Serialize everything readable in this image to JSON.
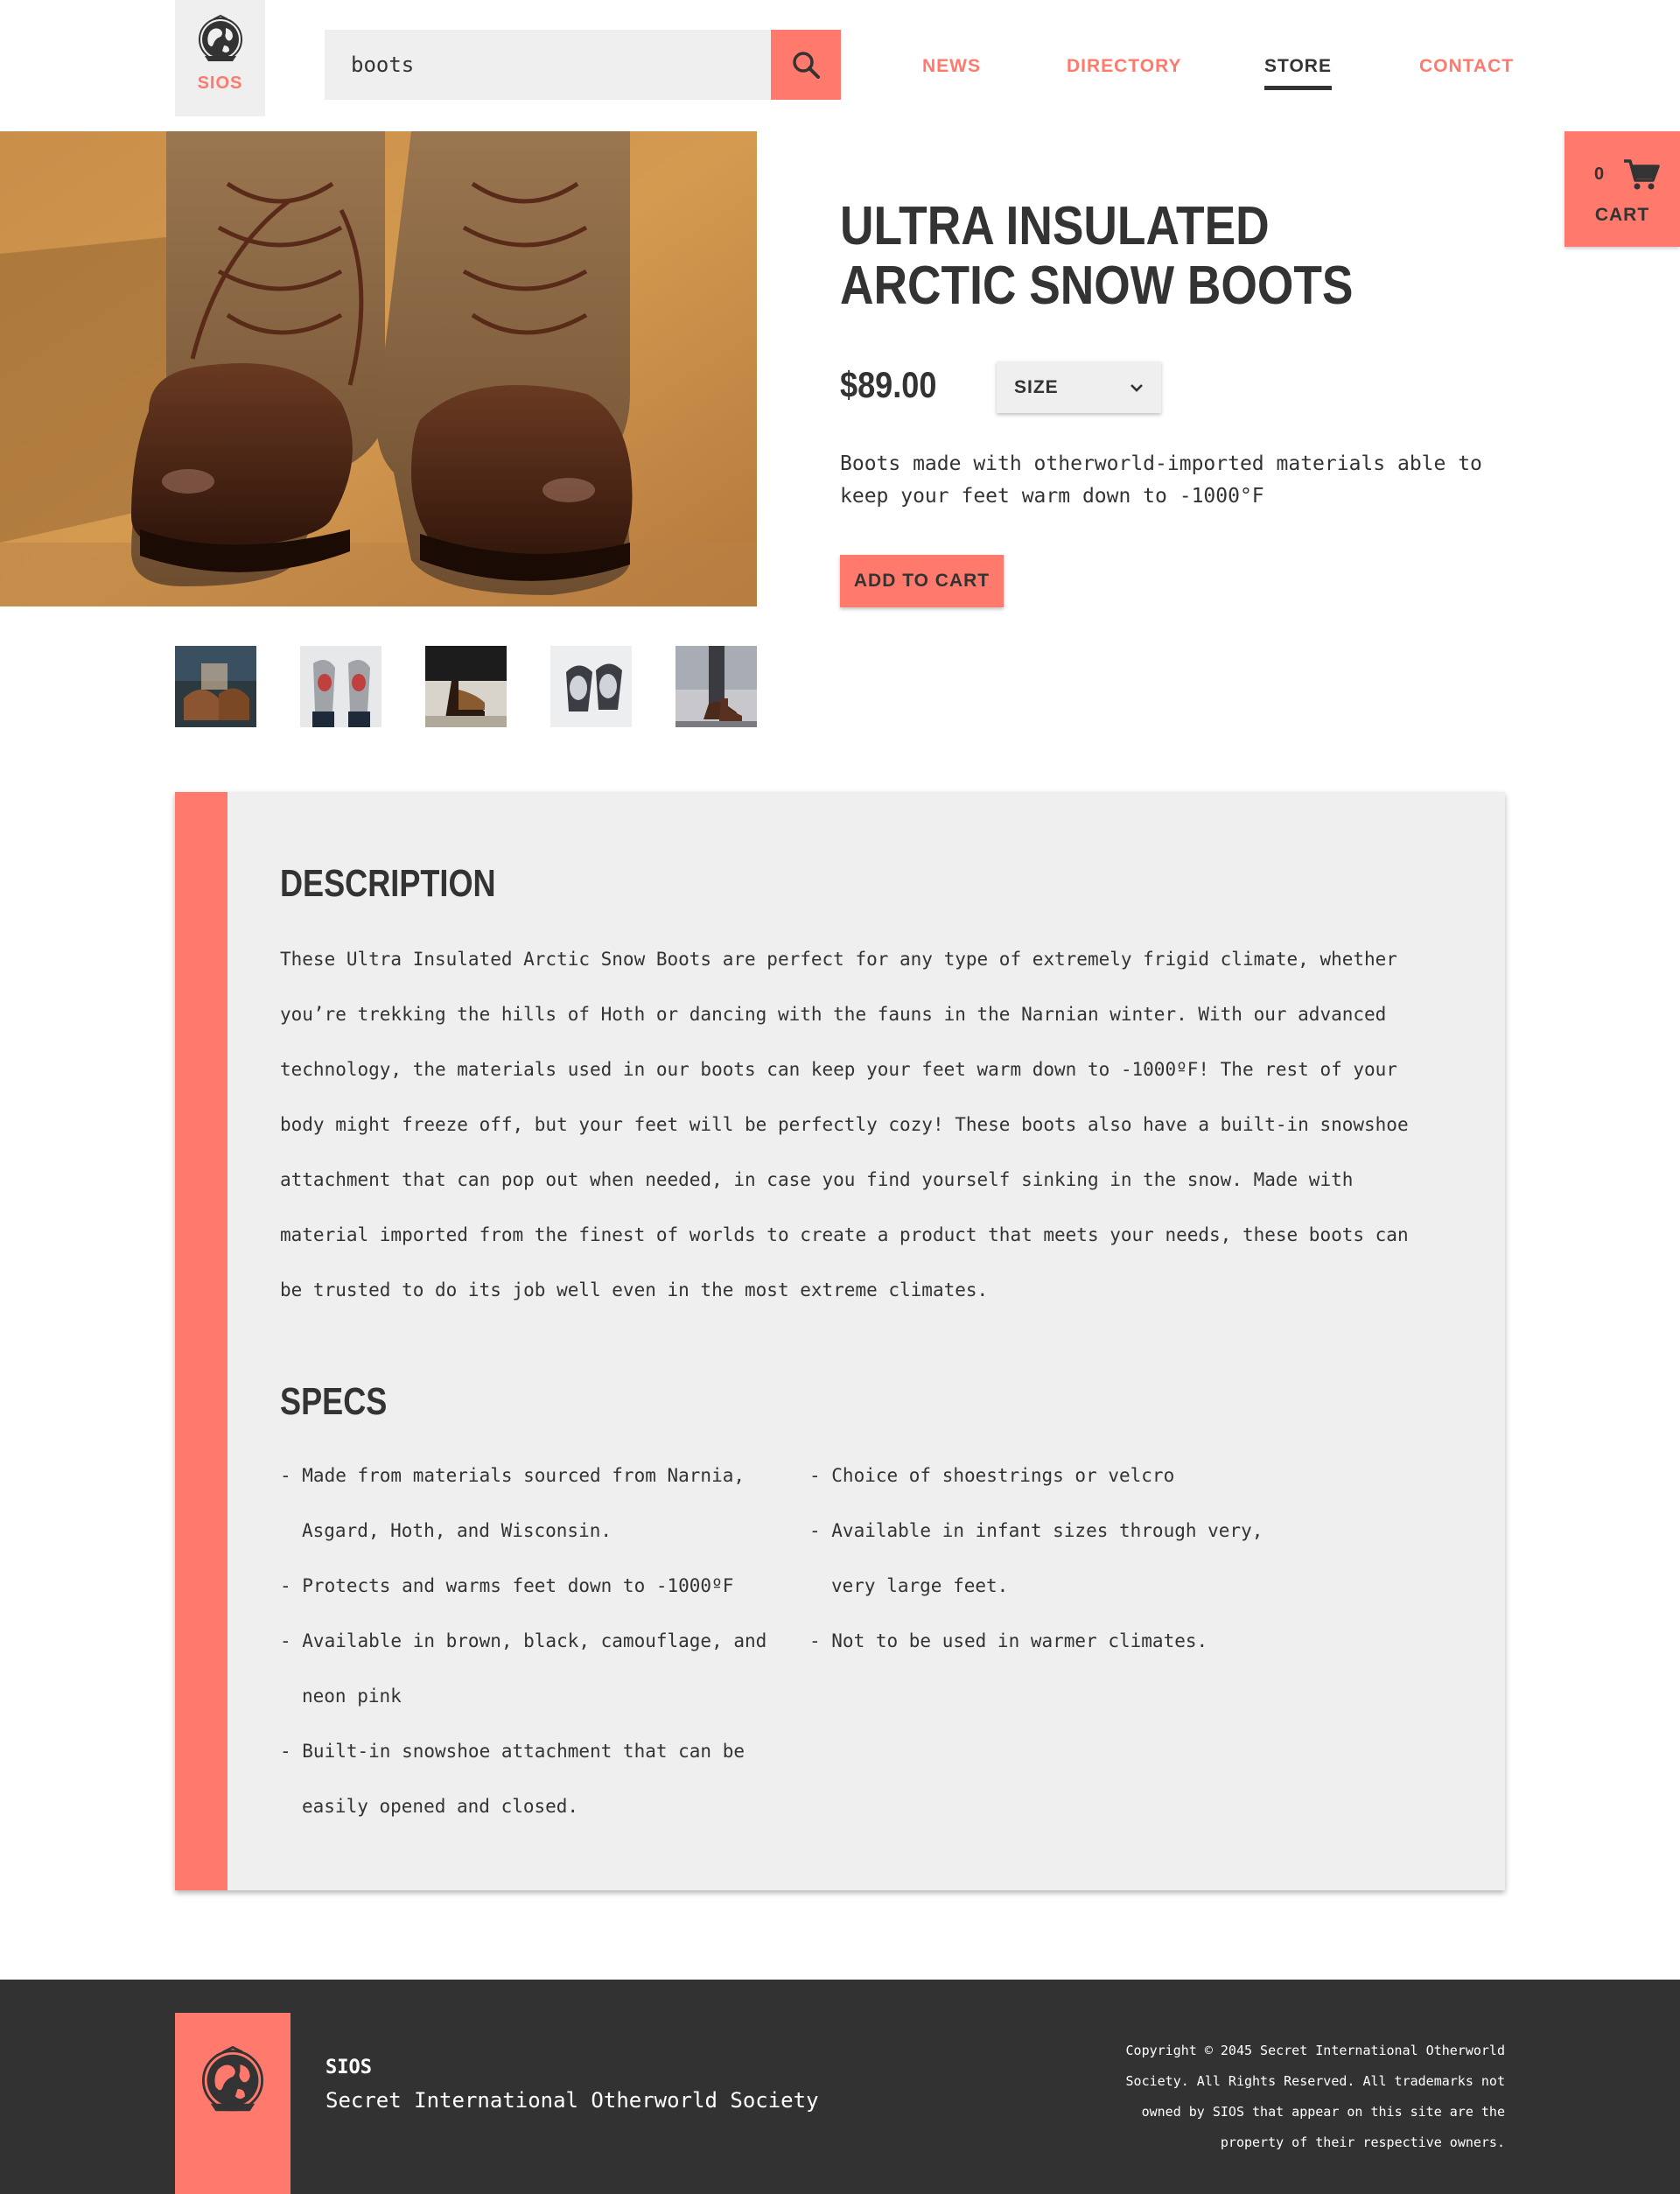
{
  "header": {
    "logo_text": "SIOS",
    "search": {
      "value": "boots"
    },
    "nav": [
      {
        "label": "NEWS",
        "active": false
      },
      {
        "label": "DIRECTORY",
        "active": false
      },
      {
        "label": "STORE",
        "active": true
      },
      {
        "label": "CONTACT",
        "active": false
      }
    ],
    "cart": {
      "count": "0",
      "label": "CART"
    }
  },
  "product": {
    "title": "ULTRA INSULATED ARCTIC SNOW BOOTS",
    "price": "$89.00",
    "size_label": "SIZE",
    "short_description": "Boots made with otherworld-imported materials able to keep your feet warm down to -1000°F",
    "add_to_cart_label": "ADD TO CART"
  },
  "details": {
    "description_heading": "DESCRIPTION",
    "description_text": "These Ultra Insulated Arctic Snow Boots are perfect for any type of extremely frigid climate, whether you’re trekking the hills of Hoth or dancing with the fauns in the Narnian winter. With our advanced technology, the materials used in our boots can keep your feet warm down to -1000ºF! The rest of your body might freeze off, but your feet will be perfectly cozy! These boots also have a built-in snowshoe attachment that can pop out when needed, in case you find yourself sinking in the snow. Made with material imported from the finest of worlds to create a product that meets your needs, these boots can be trusted to do its job well even in the most extreme climates.",
    "specs_heading": "SPECS",
    "specs_left": [
      "- Made from materials sourced from Narnia, Asgard, Hoth, and Wisconsin.",
      "- Protects and warms feet down to -1000ºF",
      "- Available in brown, black, camouflage, and neon pink",
      "- Built-in snowshoe attachment that can be easily opened and closed."
    ],
    "specs_right": [
      "- Choice of shoestrings or velcro",
      "- Available in infant sizes through very, very large feet.",
      "- Not to be used in warmer climates."
    ]
  },
  "footer": {
    "name": "SIOS",
    "full_name": "Secret International Otherworld Society",
    "copyright": "Copyright © 2045 Secret International Otherworld Society. All Rights Reserved. All trademarks not owned by SIOS that appear on this site are the property of their respective owners."
  },
  "colors": {
    "accent": "#ff7a6c",
    "dark": "#333333",
    "panel": "#efefef",
    "footer": "#323232"
  }
}
